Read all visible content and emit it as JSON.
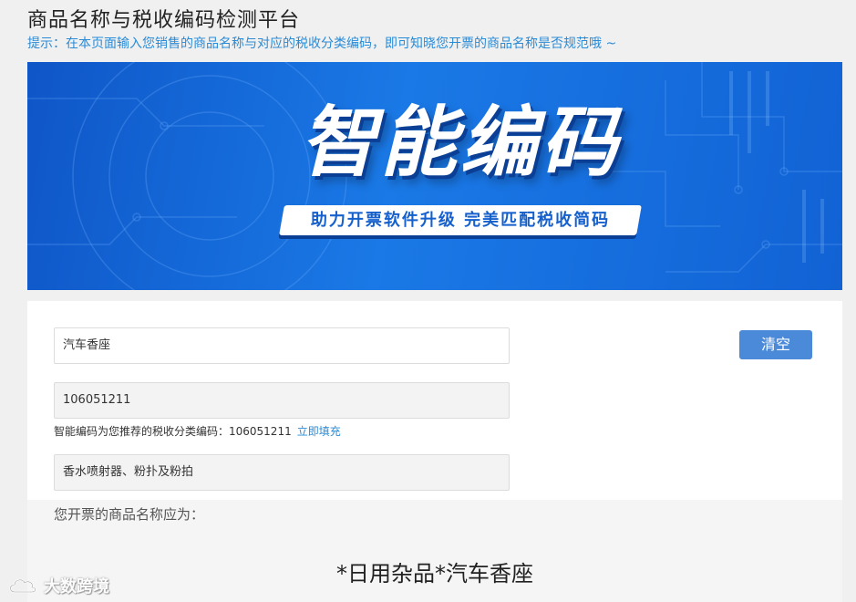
{
  "page": {
    "title": "商品名称与税收编码检测平台",
    "hint": "提示：在本页面输入您销售的商品名称与对应的税收分类编码，即可知晓您开票的商品名称是否规范哦 ~"
  },
  "banner": {
    "title": "智能编码",
    "subtitle": "助力开票软件升级 完美匹配税收简码"
  },
  "form": {
    "product_name": "汽车香座",
    "tax_code": "106051211",
    "suggestion_text": "智能编码为您推荐的税收分类编码：106051211",
    "fill_link": "立即填充",
    "category_desc": "香水喷射器、粉扑及粉拍",
    "clear_label": "清空"
  },
  "result": {
    "label": "您开票的商品名称应为：",
    "value": "*日用杂品*汽车香座"
  },
  "watermark": {
    "text": "大数跨境",
    "icon": "cloud-logo-icon"
  },
  "colors": {
    "accent": "#2a8bd6",
    "button": "#4a8ad8",
    "banner_blue": "#1a79e6"
  }
}
